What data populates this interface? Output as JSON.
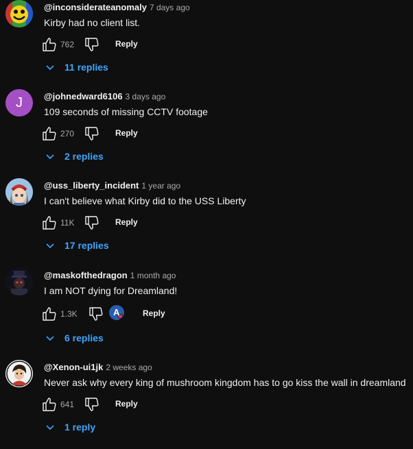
{
  "comments": [
    {
      "author": "@inconsiderateanomaly",
      "time": "7 days ago",
      "text": "Kirby had no client list.",
      "likes": "762",
      "reply_label": "Reply",
      "replies_label": "11 replies"
    },
    {
      "author": "@johnedward6106",
      "time": "3 days ago",
      "text": "109 seconds of missing CCTV footage",
      "likes": "270",
      "reply_label": "Reply",
      "replies_label": "2 replies",
      "avatar_letter": "J"
    },
    {
      "author": "@uss_liberty_incident",
      "time": "1 year ago",
      "text": "I can't believe what Kirby did to the USS Liberty",
      "likes": "11K",
      "reply_label": "Reply",
      "replies_label": "17 replies"
    },
    {
      "author": "@maskofthedragon",
      "time": "1 month ago",
      "text": "I am NOT dying for Dreamland!",
      "likes": "1.3K",
      "reply_label": "Reply",
      "replies_label": "6 replies",
      "creator_heart_letter": "A"
    },
    {
      "author": "@Xenon-ui1jk",
      "time": "2 weeks ago",
      "text": "Never ask why every king of mushroom kingdom has to go kiss the wall in dreamland",
      "likes": "641",
      "reply_label": "Reply",
      "replies_label": "1 reply"
    }
  ],
  "colors": {
    "background": "#0f0f0f",
    "link": "#3ea6ff",
    "muted": "#aaaaaa",
    "avatar_j": "#a54fc5"
  },
  "icons": {
    "like": "thumbs-up-icon",
    "dislike": "thumbs-down-icon",
    "expand": "chevron-down-icon"
  }
}
